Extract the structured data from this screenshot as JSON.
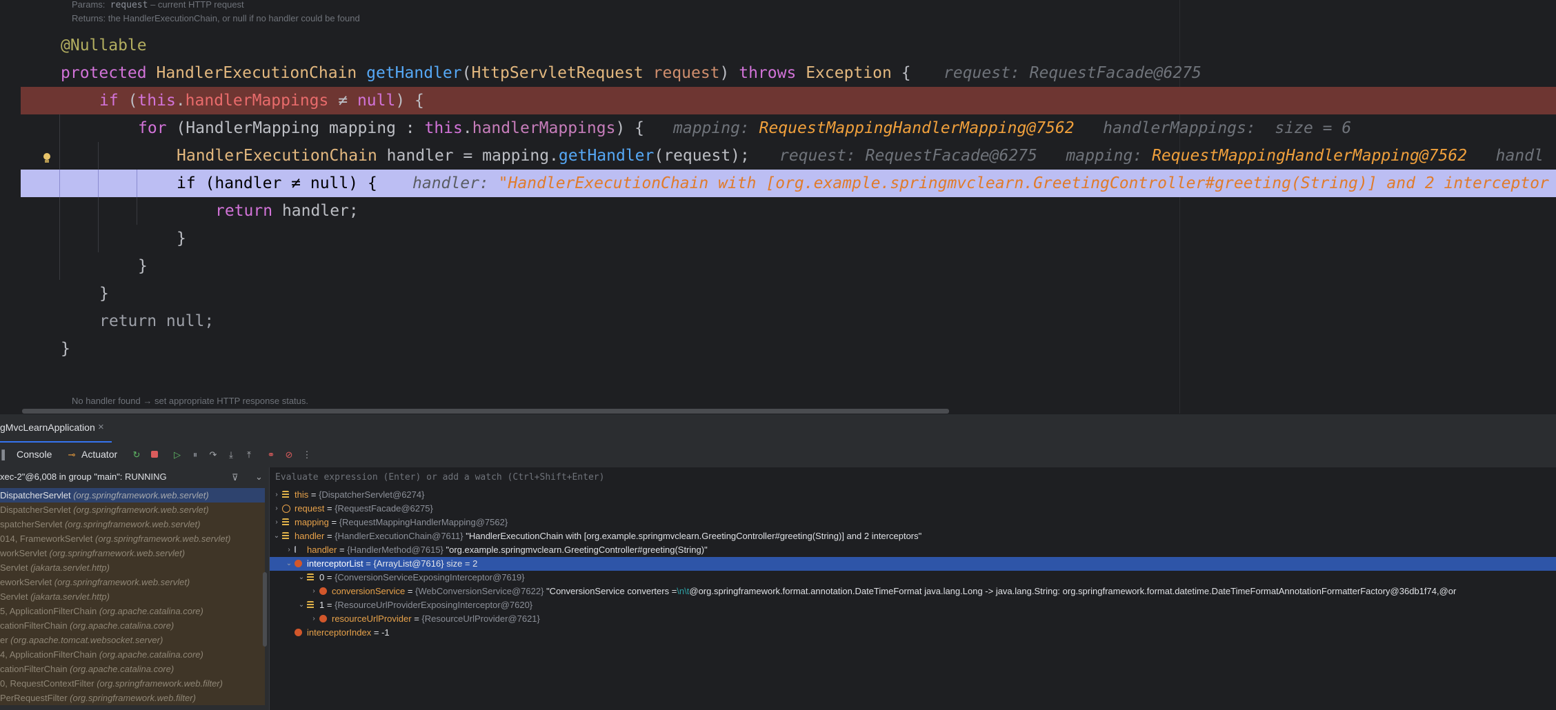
{
  "editor": {
    "doc_params_label": "Params:",
    "doc_params_code": "request",
    "doc_params_text": "– current HTTP request",
    "doc_returns": "Returns: the HandlerExecutionChain, or null if no handler could be found",
    "line_annotation": "@Nullable",
    "line_sig": {
      "protected": "protected",
      "ret_type": "HandlerExecutionChain",
      "method": "getHandler",
      "open": "(",
      "param_type": "HttpServletRequest",
      "param": "request",
      "close": ")",
      "throws": "throws",
      "exc": "Exception",
      "brace": "{",
      "hint_label": "request:",
      "hint_value": "RequestFacade@6275"
    },
    "line_if": {
      "kw": "if",
      "open": "(",
      "this": "this",
      "dot": ".",
      "field": "handlerMappings",
      "op": " ≠ ",
      "null": "null",
      "close": ") {"
    },
    "line_for": {
      "kw": "for",
      "open": "(",
      "type": "HandlerMapping",
      "var": "mapping :",
      "this": "this",
      "dot": ".",
      "field": "handlerMappings",
      "close": ") {",
      "hint1_label": "mapping:",
      "hint1_value": "RequestMappingHandlerMapping@7562",
      "hint2_label": "handlerMappings:",
      "hint2_value": "size = 6"
    },
    "line_assign": {
      "type": "HandlerExecutionChain",
      "var": "handler = mapping.",
      "method": "getHandler",
      "args": "(request);",
      "hint1_label": "request:",
      "hint1_value": "RequestFacade@6275",
      "hint2_label": "mapping:",
      "hint2_value": "RequestMappingHandlerMapping@7562",
      "hint3_label": "handl"
    },
    "line_cur": {
      "code": "if (handler ≠ null) {",
      "hint_label": "handler:",
      "hint_value": "\"HandlerExecutionChain with [org.example.springmvclearn.GreetingController#greeting(String)] and 2 interceptor"
    },
    "line_return": {
      "kw": "return",
      "rest": "handler;"
    },
    "brace": "}",
    "line_return_null": "return null;",
    "doc_footer": "No handler found → set appropriate HTTP response status."
  },
  "debug": {
    "tab_label": "gMvcLearnApplication",
    "tab_close": "×",
    "toolbar": {
      "console": "Console",
      "actuator": "Actuator",
      "more": "⋮"
    },
    "thread": "xec-2\"@6,008 in group \"main\": RUNNING",
    "frames": [
      {
        "m": "DispatcherServlet",
        "p": "(org.springframework.web.servlet)",
        "kind": "active"
      },
      {
        "m": "DispatcherServlet",
        "p": "(org.springframework.web.servlet)",
        "kind": "lib"
      },
      {
        "m": "spatcherServlet",
        "p": "(org.springframework.web.servlet)",
        "kind": "lib"
      },
      {
        "m": "014, FrameworkServlet",
        "p": "(org.springframework.web.servlet)",
        "kind": "lib"
      },
      {
        "m": "workServlet",
        "p": "(org.springframework.web.servlet)",
        "kind": "lib"
      },
      {
        "m": "Servlet",
        "p": "(jakarta.servlet.http)",
        "kind": "lib"
      },
      {
        "m": "eworkServlet",
        "p": "(org.springframework.web.servlet)",
        "kind": "lib"
      },
      {
        "m": "Servlet",
        "p": "(jakarta.servlet.http)",
        "kind": "lib"
      },
      {
        "m": "5, ApplicationFilterChain",
        "p": "(org.apache.catalina.core)",
        "kind": "lib"
      },
      {
        "m": "cationFilterChain",
        "p": "(org.apache.catalina.core)",
        "kind": "lib"
      },
      {
        "m": "er",
        "p": "(org.apache.tomcat.websocket.server)",
        "kind": "lib"
      },
      {
        "m": "4, ApplicationFilterChain",
        "p": "(org.apache.catalina.core)",
        "kind": "lib"
      },
      {
        "m": "cationFilterChain",
        "p": "(org.apache.catalina.core)",
        "kind": "lib"
      },
      {
        "m": "0, RequestContextFilter",
        "p": "(org.springframework.web.filter)",
        "kind": "lib"
      },
      {
        "m": "PerRequestFilter",
        "p": "(org.springframework.web.filter)",
        "kind": "lib"
      }
    ],
    "eval_placeholder": "Evaluate expression (Enter) or add a watch (Ctrl+Shift+Enter)",
    "variables": [
      {
        "arrow": "›",
        "icon": "bars",
        "name": "this",
        "eq": " = ",
        "type": "{DispatcherServlet@6274}",
        "value": ""
      },
      {
        "arrow": "›",
        "icon": "p",
        "name": "request",
        "eq": " = ",
        "type": "{RequestFacade@6275}",
        "value": ""
      },
      {
        "arrow": "›",
        "icon": "bars",
        "name": "mapping",
        "eq": " = ",
        "type": "{RequestMappingHandlerMapping@7562}",
        "value": ""
      },
      {
        "arrow": "⌄",
        "icon": "bars",
        "name": "handler",
        "eq": " = ",
        "type": "{HandlerExecutionChain@7611}",
        "value": " \"HandlerExecutionChain with [org.example.springmvclearn.GreetingController#greeting(String)] and 2 interceptors\""
      },
      {
        "arrow": "›",
        "icon": "flag",
        "name": "handler",
        "eq": " = ",
        "type": "{HandlerMethod@7615}",
        "value": " \"org.example.springmvclearn.GreetingController#greeting(String)\""
      },
      {
        "arrow": "⌄",
        "icon": "f",
        "name": "interceptorList",
        "eq": " = ",
        "type": "{ArrayList@7616}",
        "value": "  size = 2"
      },
      {
        "arrow": "⌄",
        "icon": "bars",
        "name": "0",
        "eq": " = ",
        "type": "{ConversionServiceExposingInterceptor@7619}",
        "value": ""
      },
      {
        "arrow": "›",
        "icon": "f",
        "name": "conversionService",
        "eq": " = ",
        "type": "{WebConversionService@7622}",
        "value": " \"ConversionService converters =",
        "esc": "\\n\\t",
        "value2": "@org.springframework.format.annotation.DateTimeFormat java.lang.Long -> java.lang.String: org.springframework.format.datetime.DateTimeFormatAnnotationFormatterFactory@36db1f74,@or"
      },
      {
        "arrow": "⌄",
        "icon": "bars",
        "name": "1",
        "eq": " = ",
        "type": "{ResourceUrlProviderExposingInterceptor@7620}",
        "value": ""
      },
      {
        "arrow": "›",
        "icon": "f",
        "name": "resourceUrlProvider",
        "eq": " = ",
        "type": "{ResourceUrlProvider@7621}",
        "value": ""
      },
      {
        "arrow": "",
        "icon": "f",
        "name": "interceptorIndex",
        "eq": " = ",
        "type": "",
        "value": "-1"
      }
    ]
  },
  "colors": {
    "breakpoint_line": "#6e3632",
    "current_line": "#bcbef3",
    "selection": "#2e55a8",
    "accent": "#3574f0"
  }
}
